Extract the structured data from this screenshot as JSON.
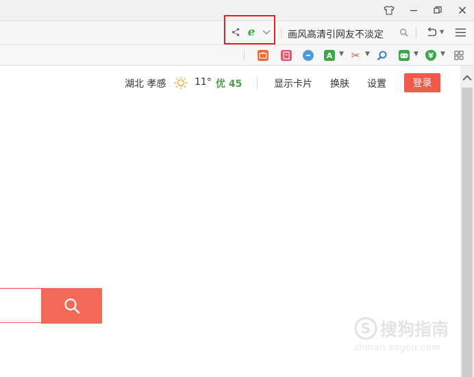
{
  "address_bar": {
    "search_text": "画风高清引网友不淡定"
  },
  "weather": {
    "city": "湖北 孝感",
    "temp": "11°",
    "aqi": "优 45"
  },
  "top_links": {
    "card": "显示卡片",
    "skin": "换肤",
    "settings": "设置",
    "login": "登录"
  },
  "watermark": {
    "brand": "搜狗指南",
    "url": "zhinan.sogou.com"
  },
  "colors": {
    "accent": "#f15a4a",
    "ie_green": "#3aa845",
    "aqi_green": "#4aa04a",
    "highlight_box": "#e02020"
  }
}
